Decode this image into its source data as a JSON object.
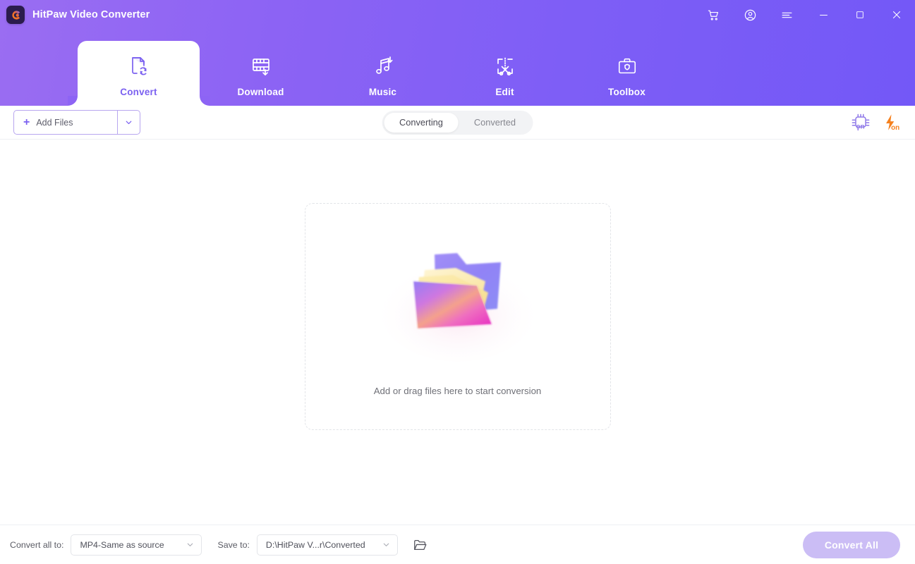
{
  "window": {
    "app_title": "HitPaw Video Converter",
    "logo_letter": "C",
    "controls": [
      {
        "name": "cart-icon",
        "label": "Cart"
      },
      {
        "name": "account-icon",
        "label": "Account"
      },
      {
        "name": "menu-icon",
        "label": "Menu"
      },
      {
        "name": "minimize-icon",
        "label": "Minimize"
      },
      {
        "name": "maximize-icon",
        "label": "Maximize"
      },
      {
        "name": "close-icon",
        "label": "Close"
      }
    ],
    "colors": {
      "header_gradient_start": "#9a6df2",
      "header_gradient_end": "#7358f7",
      "accent_purple": "#7b61f0",
      "accent_orange": "#f5811f",
      "logo_bg": "#2b1c4d"
    }
  },
  "nav": {
    "active_index": 0,
    "tabs": [
      {
        "label": "Convert",
        "icon": "convert-icon"
      },
      {
        "label": "Download",
        "icon": "download-icon"
      },
      {
        "label": "Music",
        "icon": "music-icon"
      },
      {
        "label": "Edit",
        "icon": "edit-icon"
      },
      {
        "label": "Toolbox",
        "icon": "toolbox-icon"
      }
    ]
  },
  "toolbar": {
    "add_files_label": "Add Files",
    "add_files_plus": "+",
    "segments": [
      {
        "label": "Converting",
        "active": true
      },
      {
        "label": "Converted",
        "active": false
      }
    ],
    "status_icons": [
      {
        "name": "hardware-acceleration-icon",
        "state": "on",
        "color": "#8f79e8"
      },
      {
        "name": "lightning-boost-icon",
        "state": "on",
        "color": "#f5811f"
      }
    ]
  },
  "main": {
    "dropzone_text": "Add or drag files here to start conversion",
    "illustration": "folder-illustration"
  },
  "footer": {
    "convert_all_to_label": "Convert all to:",
    "format_value": "MP4-Same as source",
    "save_to_label": "Save to:",
    "save_path_value": "D:\\HitPaw V...r\\Converted",
    "browse_icon": "open-folder-icon",
    "convert_all_button": "Convert All"
  }
}
